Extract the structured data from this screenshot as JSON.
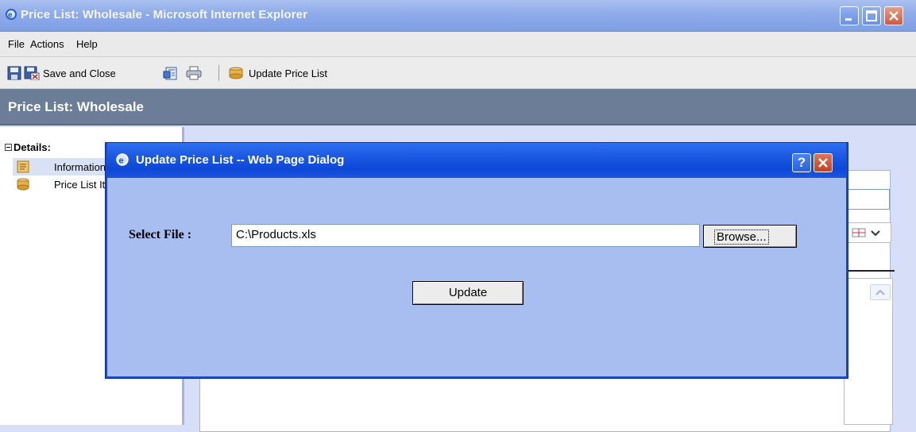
{
  "window": {
    "title": "Price List: Wholesale - Microsoft Internet Explorer"
  },
  "menu": {
    "file": "File",
    "actions": "Actions",
    "help": "Help"
  },
  "toolbar": {
    "save_and_close": "Save and Close",
    "update_price_list": "Update Price List"
  },
  "header": {
    "title": "Price List: Wholesale"
  },
  "tree": {
    "heading": "Details:",
    "items": [
      {
        "label": "Information",
        "icon": "information-icon"
      },
      {
        "label": "Price List Items",
        "icon": "price-list-items-icon"
      }
    ]
  },
  "dialog": {
    "title": "Update Price List -- Web Page Dialog",
    "select_file_label": "Select File :",
    "file_value": "C:\\Products.xls",
    "browse_label": "Browse...",
    "update_label": "Update",
    "help_glyph": "?"
  },
  "colors": {
    "titlebar": "#8eaaea",
    "header": "#6b7d97",
    "dialog_bg": "#a9bef0",
    "dialog_title": "#1f5ee6"
  }
}
